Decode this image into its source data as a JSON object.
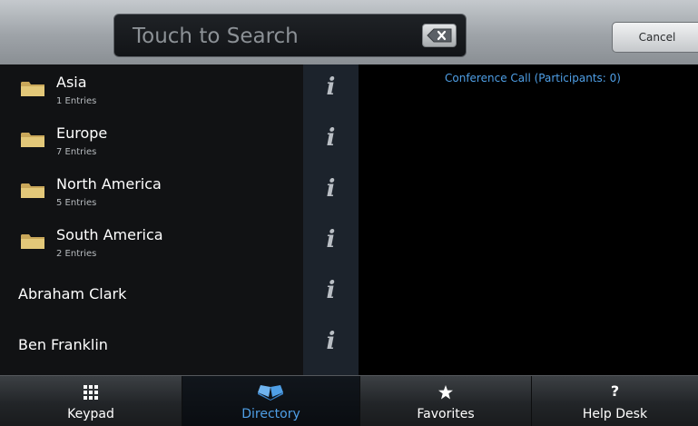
{
  "search": {
    "placeholder": "Touch to Search"
  },
  "header": {
    "cancel_label": "Cancel"
  },
  "directory": {
    "folders": [
      {
        "name": "Asia",
        "entries": "1 Entries"
      },
      {
        "name": "Europe",
        "entries": "7 Entries"
      },
      {
        "name": "North America",
        "entries": "5 Entries"
      },
      {
        "name": "South America",
        "entries": "2 Entries"
      }
    ],
    "contacts": [
      {
        "name": "Abraham Clark"
      },
      {
        "name": "Ben Franklin"
      }
    ],
    "info_glyph": "i"
  },
  "conference": {
    "title": "Conference Call (Participants: 0)"
  },
  "nav": {
    "items": [
      {
        "label": "Keypad",
        "icon": "keypad-icon"
      },
      {
        "label": "Directory",
        "icon": "book-icon",
        "active": true
      },
      {
        "label": "Favorites",
        "icon": "star-icon"
      },
      {
        "label": "Help Desk",
        "icon": "question-icon",
        "glyph": "?"
      }
    ]
  },
  "colors": {
    "accent": "#4f9fe6",
    "info_column": "#1c232c",
    "folder": "#d8b866"
  }
}
